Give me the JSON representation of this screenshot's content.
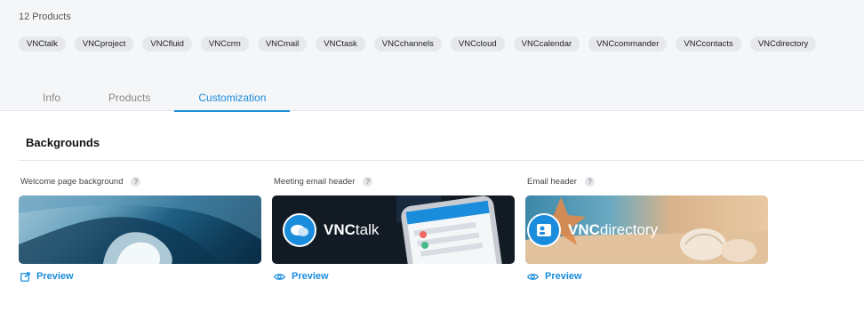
{
  "products": {
    "count_label": "12 Products",
    "chips": [
      "VNCtalk",
      "VNCproject",
      "VNCfluid",
      "VNCcrm",
      "VNCmail",
      "VNCtask",
      "VNCchannels",
      "VNCcloud",
      "VNCcalendar",
      "VNCcommander",
      "VNCcontacts",
      "VNCdirectory"
    ]
  },
  "tabs": [
    {
      "label": "Info",
      "active": false
    },
    {
      "label": "Products",
      "active": false
    },
    {
      "label": "Customization",
      "active": true
    }
  ],
  "backgrounds": {
    "title": "Backgrounds",
    "cards": [
      {
        "label": "Welcome page background",
        "help": "?",
        "preview_label": "Preview",
        "preview_icon": "external-link-icon"
      },
      {
        "label": "Meeting email header",
        "help": "?",
        "preview_label": "Preview",
        "preview_icon": "eye-icon",
        "brand_bold": "VNC",
        "brand_light": "talk"
      },
      {
        "label": "Email header",
        "help": "?",
        "preview_label": "Preview",
        "preview_icon": "eye-icon",
        "brand_bold": "VNC",
        "brand_light": "directory"
      }
    ]
  },
  "colors": {
    "accent": "#1a8cdc",
    "chip_bg": "#e6e8eb",
    "top_bg": "#f5f6f8"
  }
}
